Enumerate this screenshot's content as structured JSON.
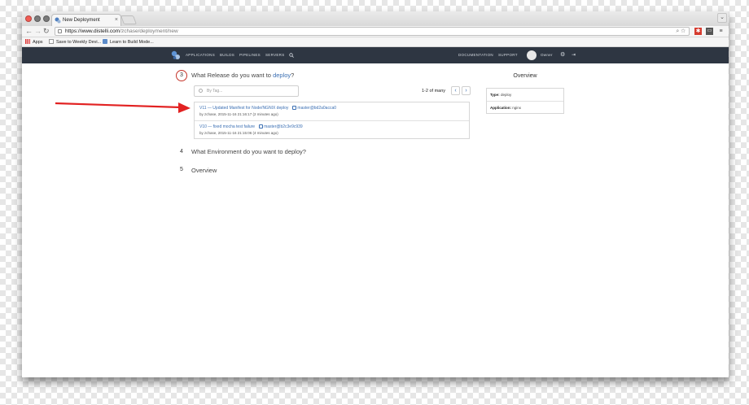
{
  "browser": {
    "tab_title": "New Deployment",
    "tab_close": "×",
    "url_host": "https://www.distelli.com",
    "url_path": "/zchase/deployment/new",
    "bookmarks": [
      "Apps",
      "Save to Weekly Devi...",
      "Learn to Build Mode..."
    ]
  },
  "nav": {
    "left": [
      "APPLICATIONS",
      "BUILDS",
      "PIPELINES",
      "SERVERS"
    ],
    "right": [
      "DOCUMENTATION",
      "SUPPORT"
    ],
    "user": "Owner"
  },
  "steps": [
    {
      "number": "3",
      "prefix": "What Release do you want to ",
      "link": "deploy",
      "suffix": "?",
      "active": true
    },
    {
      "number": "4",
      "title": "What Environment do you want to deploy?"
    },
    {
      "number": "5",
      "title": "Overview"
    }
  ],
  "search": {
    "placeholder": "By Tag..."
  },
  "pagination": {
    "label": "1-2 of many",
    "prev": "‹",
    "next": "›"
  },
  "releases": [
    {
      "title": "V11 — Updated Manifest for Node/NGNIX deploy",
      "branch": "master@bd2a0acca0",
      "meta": "by zchase, 2015-11-16 21:16:17 (2 minutes ago)"
    },
    {
      "title": "V10 — fixed mocha test failure",
      "branch": "master@b2c3e9c939",
      "meta": "by zchase, 2015-11-16 21:15:06 (4 minutes ago)"
    }
  ],
  "overview": {
    "title": "Overview",
    "rows": [
      {
        "label": "Type:",
        "value": "deploy"
      },
      {
        "label": "Application:",
        "value": "nginx"
      }
    ]
  },
  "colors": {
    "accent": "#c5342a",
    "link": "#3b6fb3",
    "nav_bg": "#2e3642",
    "arrow": "#e22222"
  }
}
